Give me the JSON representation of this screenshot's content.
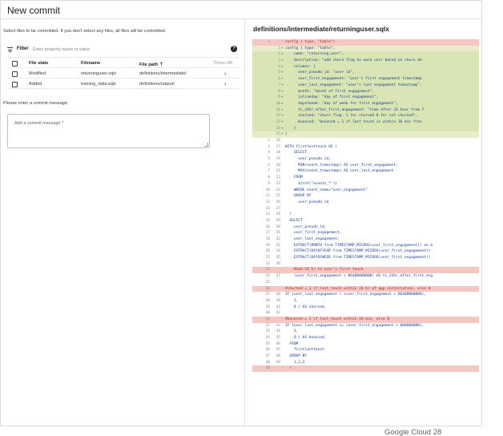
{
  "dialog": {
    "title": "New commit",
    "instruction": "Select files to be committed. If you don't select any files, all files will be committed.",
    "filter_label": "Filter",
    "filter_placeholder": "Enter property name or value",
    "help_icon": "?",
    "help_icon_name": "help-icon"
  },
  "files": {
    "headers": {
      "state": "File state",
      "name": "Filename",
      "path": "File path",
      "show": "Show diff",
      "sort": "arrow-up-icon"
    },
    "rows": [
      {
        "state": "Modified",
        "name": "returninguser.sqlx",
        "path": "definitions/intermediate/"
      },
      {
        "state": "Added",
        "name": "training_data.sqlx",
        "path": "definitions/output/"
      }
    ]
  },
  "message": {
    "label": "Please enter a commit message:",
    "placeholder": "Add a commit message",
    "required_mark": "*"
  },
  "diff": {
    "title": "definitions/intermediate/returninguser.sqlx",
    "lines": [
      {
        "o": "1",
        "n": "",
        "m": "-",
        "t": "config { type: \"table\"}",
        "k": "del"
      },
      {
        "o": "",
        "n": "1",
        "m": "+",
        "t": "config { type: \"table\",",
        "k": "add"
      },
      {
        "o": "",
        "n": "2",
        "m": "+",
        "t": "    name: \"returning_user\",",
        "k": "addmid"
      },
      {
        "o": "",
        "n": "3",
        "m": "+",
        "t": "    description: \"add churn flag to each user based on churn de",
        "k": "addmid"
      },
      {
        "o": "",
        "n": "4",
        "m": "+",
        "t": "    columns: {",
        "k": "addmid"
      },
      {
        "o": "",
        "n": "5",
        "m": "+",
        "t": "      user_pseudo_id: \"user id\",",
        "k": "addmid"
      },
      {
        "o": "",
        "n": "6",
        "m": "+",
        "t": "      user_first_engagement: \"user's first engagement timestamp",
        "k": "addmid"
      },
      {
        "o": "",
        "n": "7",
        "m": "+",
        "t": "      user_last_engagement: \"user's last engagement timestamp\",",
        "k": "addmid"
      },
      {
        "o": "",
        "n": "8",
        "m": "+",
        "t": "      month: \"month of first engagement\",",
        "k": "addmid"
      },
      {
        "o": "",
        "n": "9",
        "m": "+",
        "t": "      julianday: \"day of first engagement\",",
        "k": "addmid"
      },
      {
        "o": "",
        "n": "10",
        "m": "+",
        "t": "      dayofweek: \"day of week for first engagement\",",
        "k": "addmid"
      },
      {
        "o": "",
        "n": "11",
        "m": "+",
        "t": "      ts_24hr_after_first_engagement: \"time after 24 hour from f",
        "k": "addmid"
      },
      {
        "o": "",
        "n": "12",
        "m": "+",
        "t": "      churned: \"churn flag. 1 for churned 0 for not churned\",",
        "k": "addmid"
      },
      {
        "o": "",
        "n": "13",
        "m": "+",
        "t": "      bounced: \"bounced = 1 if last touch is within 10 min fron",
        "k": "addmid"
      },
      {
        "o": "",
        "n": "14",
        "m": "+",
        "t": "    }",
        "k": "addmid"
      },
      {
        "o": "",
        "n": "15",
        "m": "+",
        "t": "}",
        "k": "add"
      },
      {
        "o": "2",
        "n": "16",
        "m": "",
        "t": "",
        "k": "ctx"
      },
      {
        "o": "3",
        "n": "17",
        "m": "",
        "t": "WITH firstlasttouch AS (",
        "k": "ctx"
      },
      {
        "o": "4",
        "n": "18",
        "m": "",
        "t": "    SELECT",
        "k": "ctx"
      },
      {
        "o": "5",
        "n": "19",
        "m": "",
        "t": "      user_pseudo_id,",
        "k": "ctx"
      },
      {
        "o": "6",
        "n": "20",
        "m": "",
        "t": "      MIN(event_timestamp) AS user_first_engagement,",
        "k": "ctx"
      },
      {
        "o": "7",
        "n": "21",
        "m": "",
        "t": "      MAX(event_timestamp) AS user_last_engagement",
        "k": "ctx"
      },
      {
        "o": "8",
        "n": "22",
        "m": "",
        "t": "    FROM",
        "k": "ctx"
      },
      {
        "o": "9",
        "n": "23",
        "m": "",
        "t": "      ${ref(\"events_*\")}",
        "k": "ctx"
      },
      {
        "o": "10",
        "n": "24",
        "m": "",
        "t": "    WHERE event_name=\"user_engagement\"",
        "k": "ctx"
      },
      {
        "o": "11",
        "n": "25",
        "m": "",
        "t": "    GROUP BY",
        "k": "ctx"
      },
      {
        "o": "12",
        "n": "26",
        "m": "",
        "t": "      user_pseudo_id",
        "k": "ctx"
      },
      {
        "o": "13",
        "n": "27",
        "m": "",
        "t": "",
        "k": "ctx"
      },
      {
        "o": "14",
        "n": "28",
        "m": "",
        "t": "  )",
        "k": "ctx"
      },
      {
        "o": "15",
        "n": "29",
        "m": "",
        "t": "  SELECT",
        "k": "ctx"
      },
      {
        "o": "16",
        "n": "30",
        "m": "",
        "t": "    user_pseudo_id,",
        "k": "ctx"
      },
      {
        "o": "17",
        "n": "31",
        "m": "",
        "t": "    user_first_engagement,",
        "k": "ctx"
      },
      {
        "o": "18",
        "n": "32",
        "m": "",
        "t": "    user_last_engagement,",
        "k": "ctx"
      },
      {
        "o": "19",
        "n": "33",
        "m": "",
        "t": "    EXTRACT(MONTH from TIMESTAMP_MICROS(user_first_engagement)) as m",
        "k": "ctx"
      },
      {
        "o": "20",
        "n": "34",
        "m": "",
        "t": "    EXTRACT(DAYOFYEAR from TIMESTAMP_MICROS(user_first_engagement))",
        "k": "ctx"
      },
      {
        "o": "21",
        "n": "35",
        "m": "",
        "t": "    EXTRACT(DAYOFWEEK from TIMESTAMP_MICROS(user_first_engagement))",
        "k": "ctx"
      },
      {
        "o": "22",
        "n": "36",
        "m": "",
        "t": "",
        "k": "ctx"
      },
      {
        "o": "23",
        "n": "",
        "m": "-",
        "t": "    #add 24 hr to user's first touch",
        "k": "del"
      },
      {
        "o": "24",
        "n": "37",
        "m": "",
        "t": "    (user_first_engagement + 86400000000) AS ts_24hr_after_first_eng",
        "k": "ctx"
      },
      {
        "o": "25",
        "n": "",
        "m": "",
        "t": "",
        "k": "ctx"
      },
      {
        "o": "26",
        "n": "",
        "m": "-",
        "t": "#churned = 1 if last_touch within 24 hr of app installation, else 0",
        "k": "del"
      },
      {
        "o": "27",
        "n": "38",
        "m": "",
        "t": "IF (user_last_engagement < (user_first_engagement + 86400000000),",
        "k": "ctx"
      },
      {
        "o": "28",
        "n": "39",
        "m": "",
        "t": "    1,",
        "k": "ctx"
      },
      {
        "o": "29",
        "n": "41",
        "m": "",
        "t": "    0 ) AS churned,",
        "k": "ctx"
      },
      {
        "o": "30",
        "n": "42",
        "m": "",
        "t": "",
        "k": "ctx"
      },
      {
        "o": "31",
        "n": "",
        "m": "-",
        "t": "#bounced = 1 if last_touch within 10 min, else 0",
        "k": "del"
      },
      {
        "o": "32",
        "n": "43",
        "m": "",
        "t": "IF (user_last_engagement <= (user_first_engagement + 600000000),",
        "k": "ctx"
      },
      {
        "o": "33",
        "n": "44",
        "m": "",
        "t": "    1,",
        "k": "ctx"
      },
      {
        "o": "34",
        "n": "45",
        "m": "",
        "t": "    0 ) AS bounced,",
        "k": "ctx"
      },
      {
        "o": "35",
        "n": "46",
        "m": "",
        "t": "  FROM",
        "k": "ctx"
      },
      {
        "o": "36",
        "n": "47",
        "m": "",
        "t": "    firstlasttouch",
        "k": "ctx"
      },
      {
        "o": "37",
        "n": "48",
        "m": "",
        "t": "  GROUP BY",
        "k": "ctx"
      },
      {
        "o": "38",
        "n": "49",
        "m": "",
        "t": "    1,2,3",
        "k": "ctx"
      },
      {
        "o": "39",
        "n": "",
        "m": "-",
        "t": "  )",
        "k": "del"
      }
    ]
  },
  "watermark": "Google Cloud  28"
}
